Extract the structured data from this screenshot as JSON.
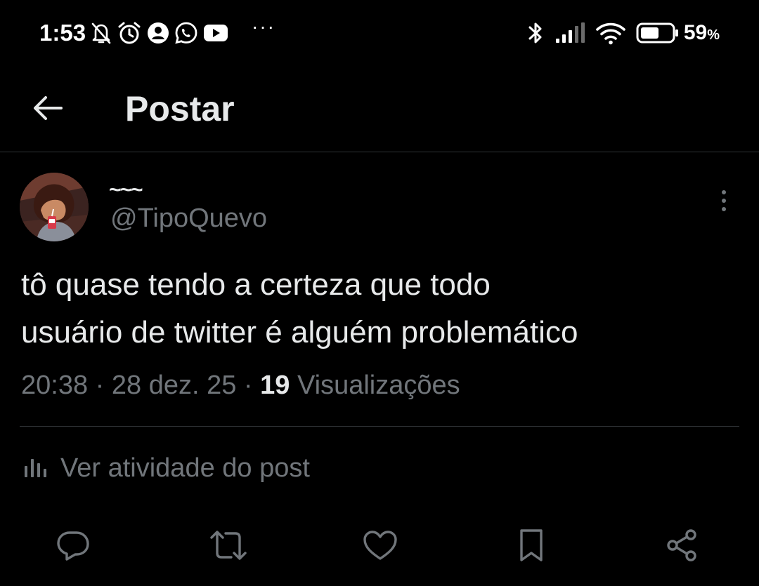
{
  "status_bar": {
    "time": "1:53",
    "more": "···",
    "battery_percent": "59",
    "battery_unit": "%",
    "battery_level": 0.59,
    "icons_left": [
      "bell-off-icon",
      "alarm-icon",
      "app-notification-icon",
      "whatsapp-icon",
      "youtube-icon"
    ],
    "icons_right": [
      "bluetooth-icon",
      "signal-icon",
      "wifi-icon",
      "battery-icon"
    ]
  },
  "header": {
    "title": "Postar",
    "back_icon": "arrow-left-icon"
  },
  "post": {
    "display_name": "~~~",
    "handle": "@TipoQuevo",
    "text_line_1": "tô quase tendo a certeza que todo",
    "text_line_2": "usuário de twitter é alguém problemático",
    "time": "20:38",
    "sep1": "·",
    "date": "28 dez. 25",
    "sep2": "·",
    "views_count": "19",
    "views_label": "Visualizações",
    "activity_label": "Ver atividade do post"
  },
  "actions": {
    "icons": [
      "reply-icon",
      "repost-icon",
      "like-icon",
      "bookmark-icon",
      "share-icon"
    ]
  },
  "colors": {
    "background": "#000000",
    "text_primary": "#e7e9ea",
    "text_secondary": "#71767b",
    "divider": "#2f3336"
  }
}
